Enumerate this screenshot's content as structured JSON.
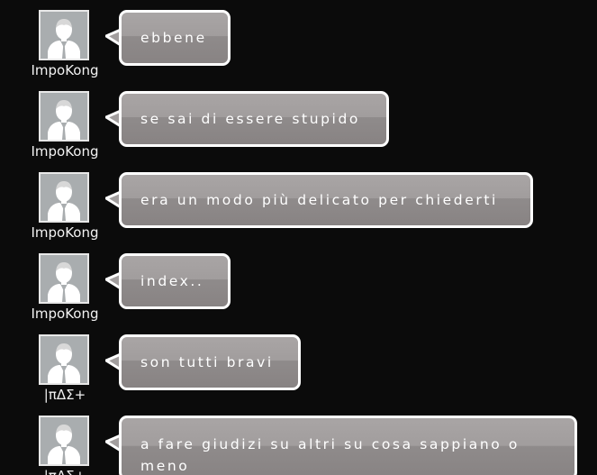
{
  "messages": [
    {
      "user": "ImpoKong",
      "text": "ebbene"
    },
    {
      "user": "ImpoKong",
      "text": "se sai di essere stupido"
    },
    {
      "user": "ImpoKong",
      "text": "era un modo più delicato per chiederti"
    },
    {
      "user": "ImpoKong",
      "text": "index.."
    },
    {
      "user": "|πΔΣ+",
      "text": "son tutti bravi"
    },
    {
      "user": "|πΔΣ+",
      "text": "a fare giudizi su altri su cosa sappiano o meno"
    }
  ],
  "icons": {
    "avatar": "default-user-avatar-icon",
    "bubble_tail": "speech-bubble-tail-icon"
  },
  "colors": {
    "background": "#0b0b0b",
    "bubble_border": "#ffffff",
    "bubble_fill": "#a19d9d",
    "text": "#ffffff",
    "avatar_bg": "#a9adaf"
  }
}
